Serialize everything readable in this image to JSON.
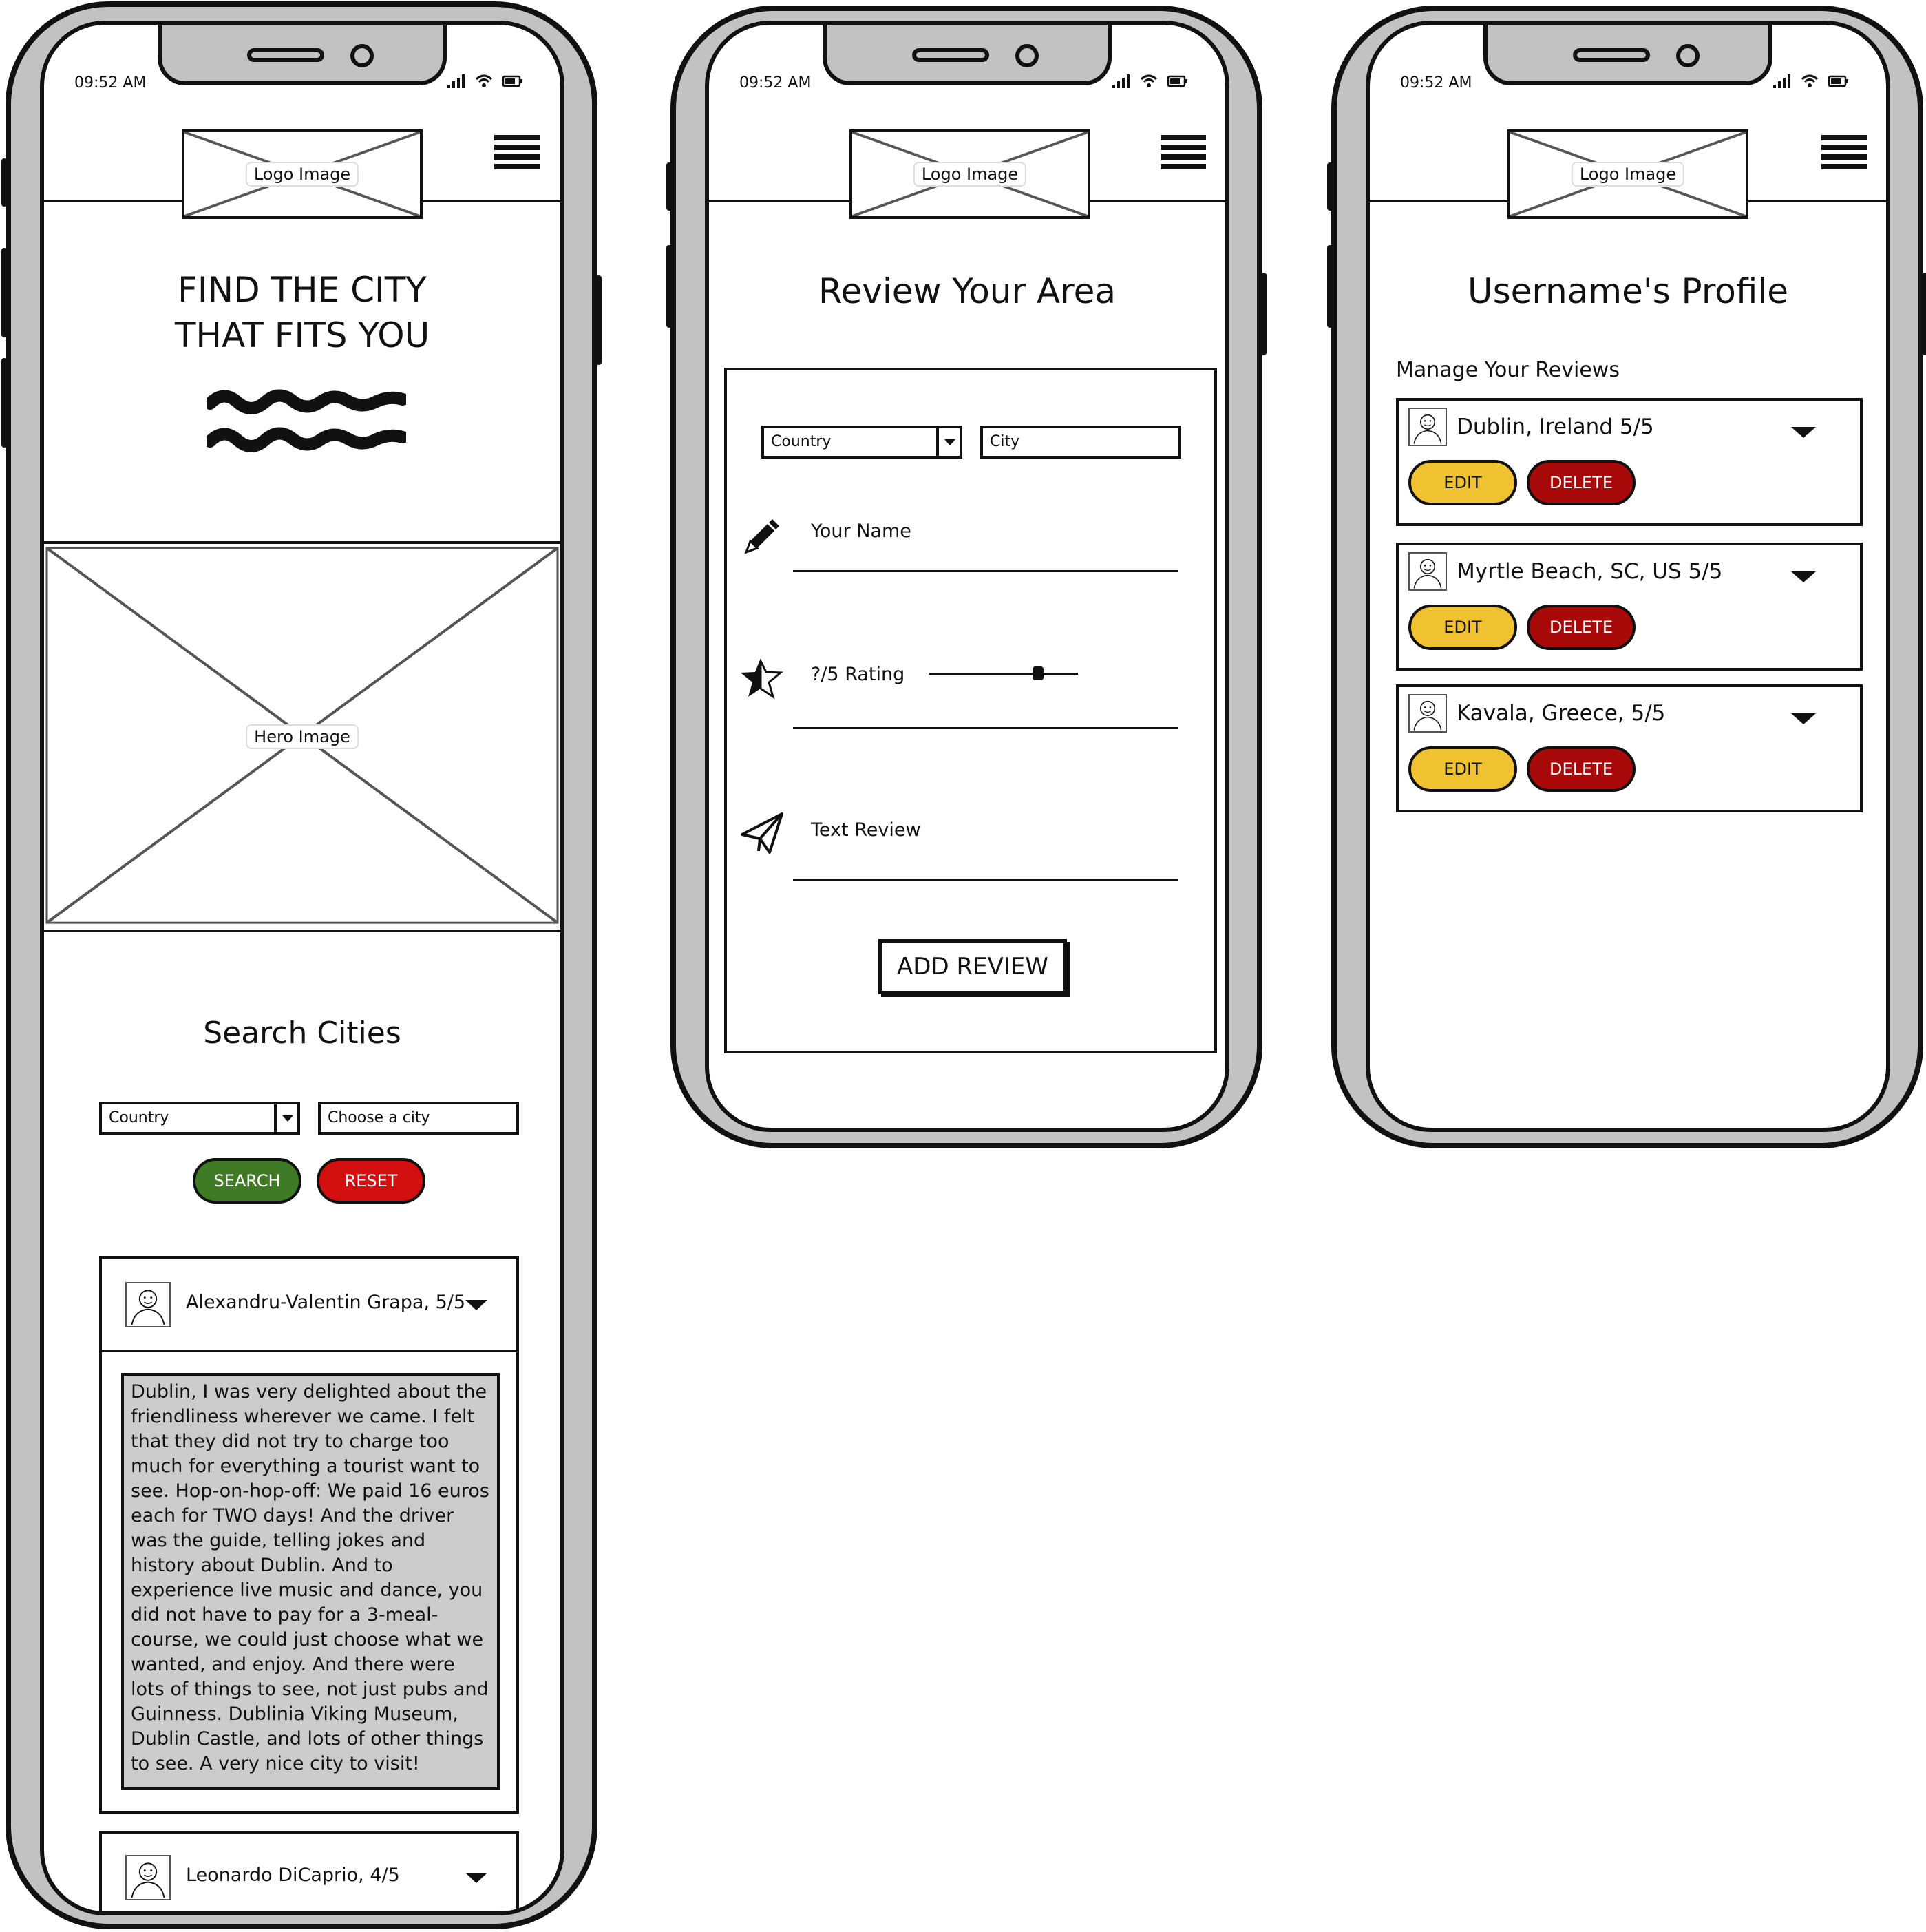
{
  "status_bar": {
    "time": "09:52 AM"
  },
  "header": {
    "logo_label": "Logo Image"
  },
  "home": {
    "hero_title_line1": "FIND THE CITY",
    "hero_title_line2": "THAT FITS YOU",
    "hero_image_label": "Hero Image",
    "search_title": "Search Cities",
    "country_select": "Country",
    "city_select": "Choose a city",
    "search_label": "SEARCH",
    "reset_label": "RESET",
    "reviews": [
      {
        "author": "Alexandru-Valentin Grapa, 5/5",
        "text": "Dublin, I was very delighted about the friendliness wherever we came. I felt that they did not try to charge too much for everything a tourist want to see. Hop-on-hop-off: We paid 16 euros each for TWO days! And the driver was the guide, telling jokes and history about Dublin. And to experience live music and dance, you did not have to pay for a 3-meal-course, we could just choose what we wanted, and enjoy. And there were lots of things to see, not just pubs and Guinness. Dublinia Viking Museum, Dublin Castle, and lots of other things to see. A very nice city to visit!"
      },
      {
        "author": "Leonardo DiCaprio, 4/5"
      }
    ]
  },
  "review_form": {
    "title": "Review Your Area",
    "country_select": "Country",
    "city_input": "City",
    "name_label": "Your Name",
    "rating_label": "?/5 Rating",
    "rating_value_fraction": 0.75,
    "text_label": "Text Review",
    "submit_label": "ADD REVIEW"
  },
  "profile": {
    "title": "Username's Profile",
    "subtitle": "Manage Your Reviews",
    "edit_label": "EDIT",
    "delete_label": "DELETE",
    "reviews": [
      {
        "title": "Dublin, Ireland 5/5"
      },
      {
        "title": "Myrtle Beach, SC, US 5/5"
      },
      {
        "title": "Kavala, Greece, 5/5"
      }
    ]
  },
  "colors": {
    "frame": "#c2c2c2",
    "search_green": "#3f7a25",
    "reset_red": "#d30f0f",
    "edit_yellow": "#f0c232",
    "delete_red": "#a80a0a",
    "review_text_bg": "#cccccc"
  }
}
